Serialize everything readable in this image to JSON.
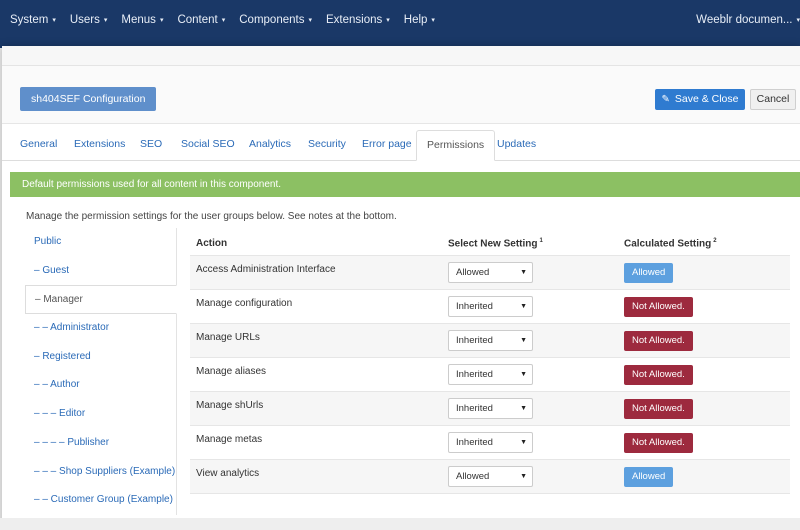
{
  "navbar": {
    "menu": [
      {
        "label": "System",
        "name": "nav-system"
      },
      {
        "label": "Users",
        "name": "nav-users"
      },
      {
        "label": "Menus",
        "name": "nav-menus"
      },
      {
        "label": "Content",
        "name": "nav-content"
      },
      {
        "label": "Components",
        "name": "nav-components"
      },
      {
        "label": "Extensions",
        "name": "nav-extensions"
      },
      {
        "label": "Help",
        "name": "nav-help"
      }
    ],
    "site_name": "Weeblr documen...",
    "caret": "▾"
  },
  "toolbar": {
    "title": "sh404SEF Configuration",
    "save_label": "Save & Close",
    "save_icon": "✎",
    "cancel_label": "Cancel"
  },
  "tabs": [
    "General",
    "Extensions",
    "SEO",
    "Social SEO",
    "Analytics",
    "Security",
    "Error page",
    "Permissions",
    "Updates"
  ],
  "active_tab": "Permissions",
  "alert": "Default permissions used for all content in this component.",
  "intro": "Manage the permission settings for the user groups below. See notes at the bottom.",
  "groups": [
    "Public",
    "– Guest",
    "– Manager",
    "– – Administrator",
    "– Registered",
    "– – Author",
    "– – – Editor",
    "– – – – Publisher",
    "– – – Shop Suppliers (Example)",
    "– – Customer Group (Example)"
  ],
  "active_group": "– Manager",
  "table": {
    "head_action": "Action",
    "head_select": "Select New Setting",
    "head_select_note": "1",
    "head_calc": "Calculated Setting",
    "head_calc_note": "2",
    "rows": [
      {
        "action": "Access Administration Interface",
        "setting": "Allowed",
        "calculated": "Allowed",
        "status": "allowed"
      },
      {
        "action": "Manage configuration",
        "setting": "Inherited",
        "calculated": "Not Allowed.",
        "status": "denied"
      },
      {
        "action": "Manage URLs",
        "setting": "Inherited",
        "calculated": "Not Allowed.",
        "status": "denied"
      },
      {
        "action": "Manage aliases",
        "setting": "Inherited",
        "calculated": "Not Allowed.",
        "status": "denied"
      },
      {
        "action": "Manage shUrls",
        "setting": "Inherited",
        "calculated": "Not Allowed.",
        "status": "denied"
      },
      {
        "action": "Manage metas",
        "setting": "Inherited",
        "calculated": "Not Allowed.",
        "status": "denied"
      },
      {
        "action": "View analytics",
        "setting": "Allowed",
        "calculated": "Allowed",
        "status": "allowed"
      }
    ],
    "select_arrow": "▼"
  },
  "colors": {
    "navbar": "#1a3867",
    "alert": "#8cc063",
    "allowed": "#5da0df",
    "not_allowed": "#9d2a3e",
    "primary_button": "#2f7bd0"
  }
}
